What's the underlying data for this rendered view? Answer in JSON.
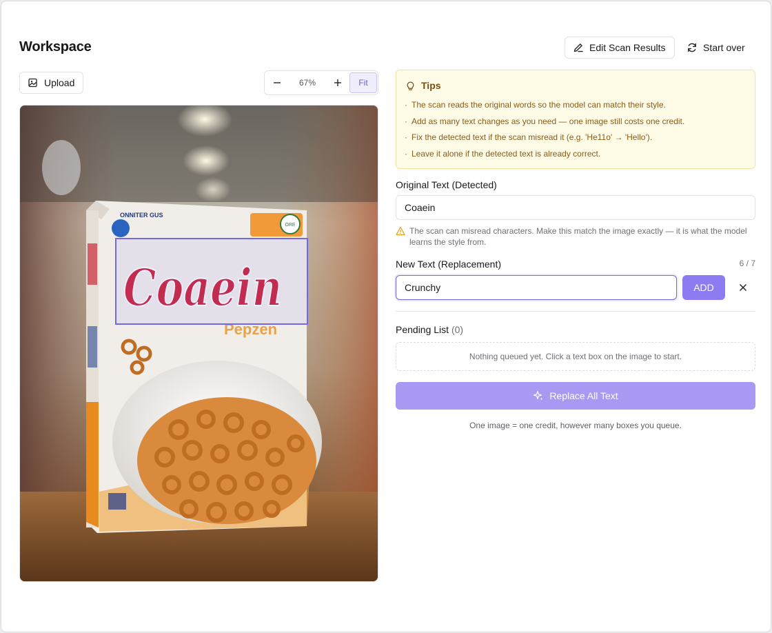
{
  "header": {
    "title": "Workspace",
    "edit_scan_label": "Edit Scan Results",
    "start_over_label": "Start over"
  },
  "toolbar": {
    "upload_label": "Upload",
    "zoom_value": "67%",
    "zoom_percent": 67,
    "fit_label": "Fit"
  },
  "image": {
    "box_brand_text": "ONNITER GUS",
    "detected_word": "Coaein",
    "sub_brand_text": "Pepzen",
    "badge_text": "ORE"
  },
  "tips": {
    "title": "Tips",
    "items": [
      "The scan reads the original words so the model can match their style.",
      "Add as many text changes as you need — one image still costs one credit.",
      "Fix the detected text if the scan misread it (e.g. 'He11o' → 'Hello').",
      "Leave it alone if the detected text is already correct."
    ]
  },
  "original": {
    "label": "Original Text (Detected)",
    "value": "Coaein",
    "warning": "The scan can misread characters. Make this match the image exactly — it is what the model learns the style from."
  },
  "replacement": {
    "label": "New Text (Replacement)",
    "char_count": "6 / 7",
    "value": "Crunchy",
    "add_label": "ADD"
  },
  "pending": {
    "label": "Pending List",
    "count": "(0)",
    "empty_text": "Nothing queued yet. Click a text box on the image to start."
  },
  "actions": {
    "replace_all_label": "Replace All Text",
    "credit_note": "One image = one credit, however many boxes you queue."
  },
  "colors": {
    "accent": "#8d7cf1",
    "accent_disabled": "#a999f2",
    "tips_bg": "#fefbe6",
    "tips_text": "#8a5a18",
    "warning_icon": "#e2a21b"
  },
  "icons": {
    "edit": "pencil-icon",
    "start_over": "refresh-icon",
    "upload": "image-upload-icon",
    "zoom_out": "minus-icon",
    "zoom_in": "plus-icon",
    "tips": "lightbulb-icon",
    "warning": "warning-triangle-icon",
    "clear": "close-icon",
    "replace": "sparkles-icon"
  }
}
